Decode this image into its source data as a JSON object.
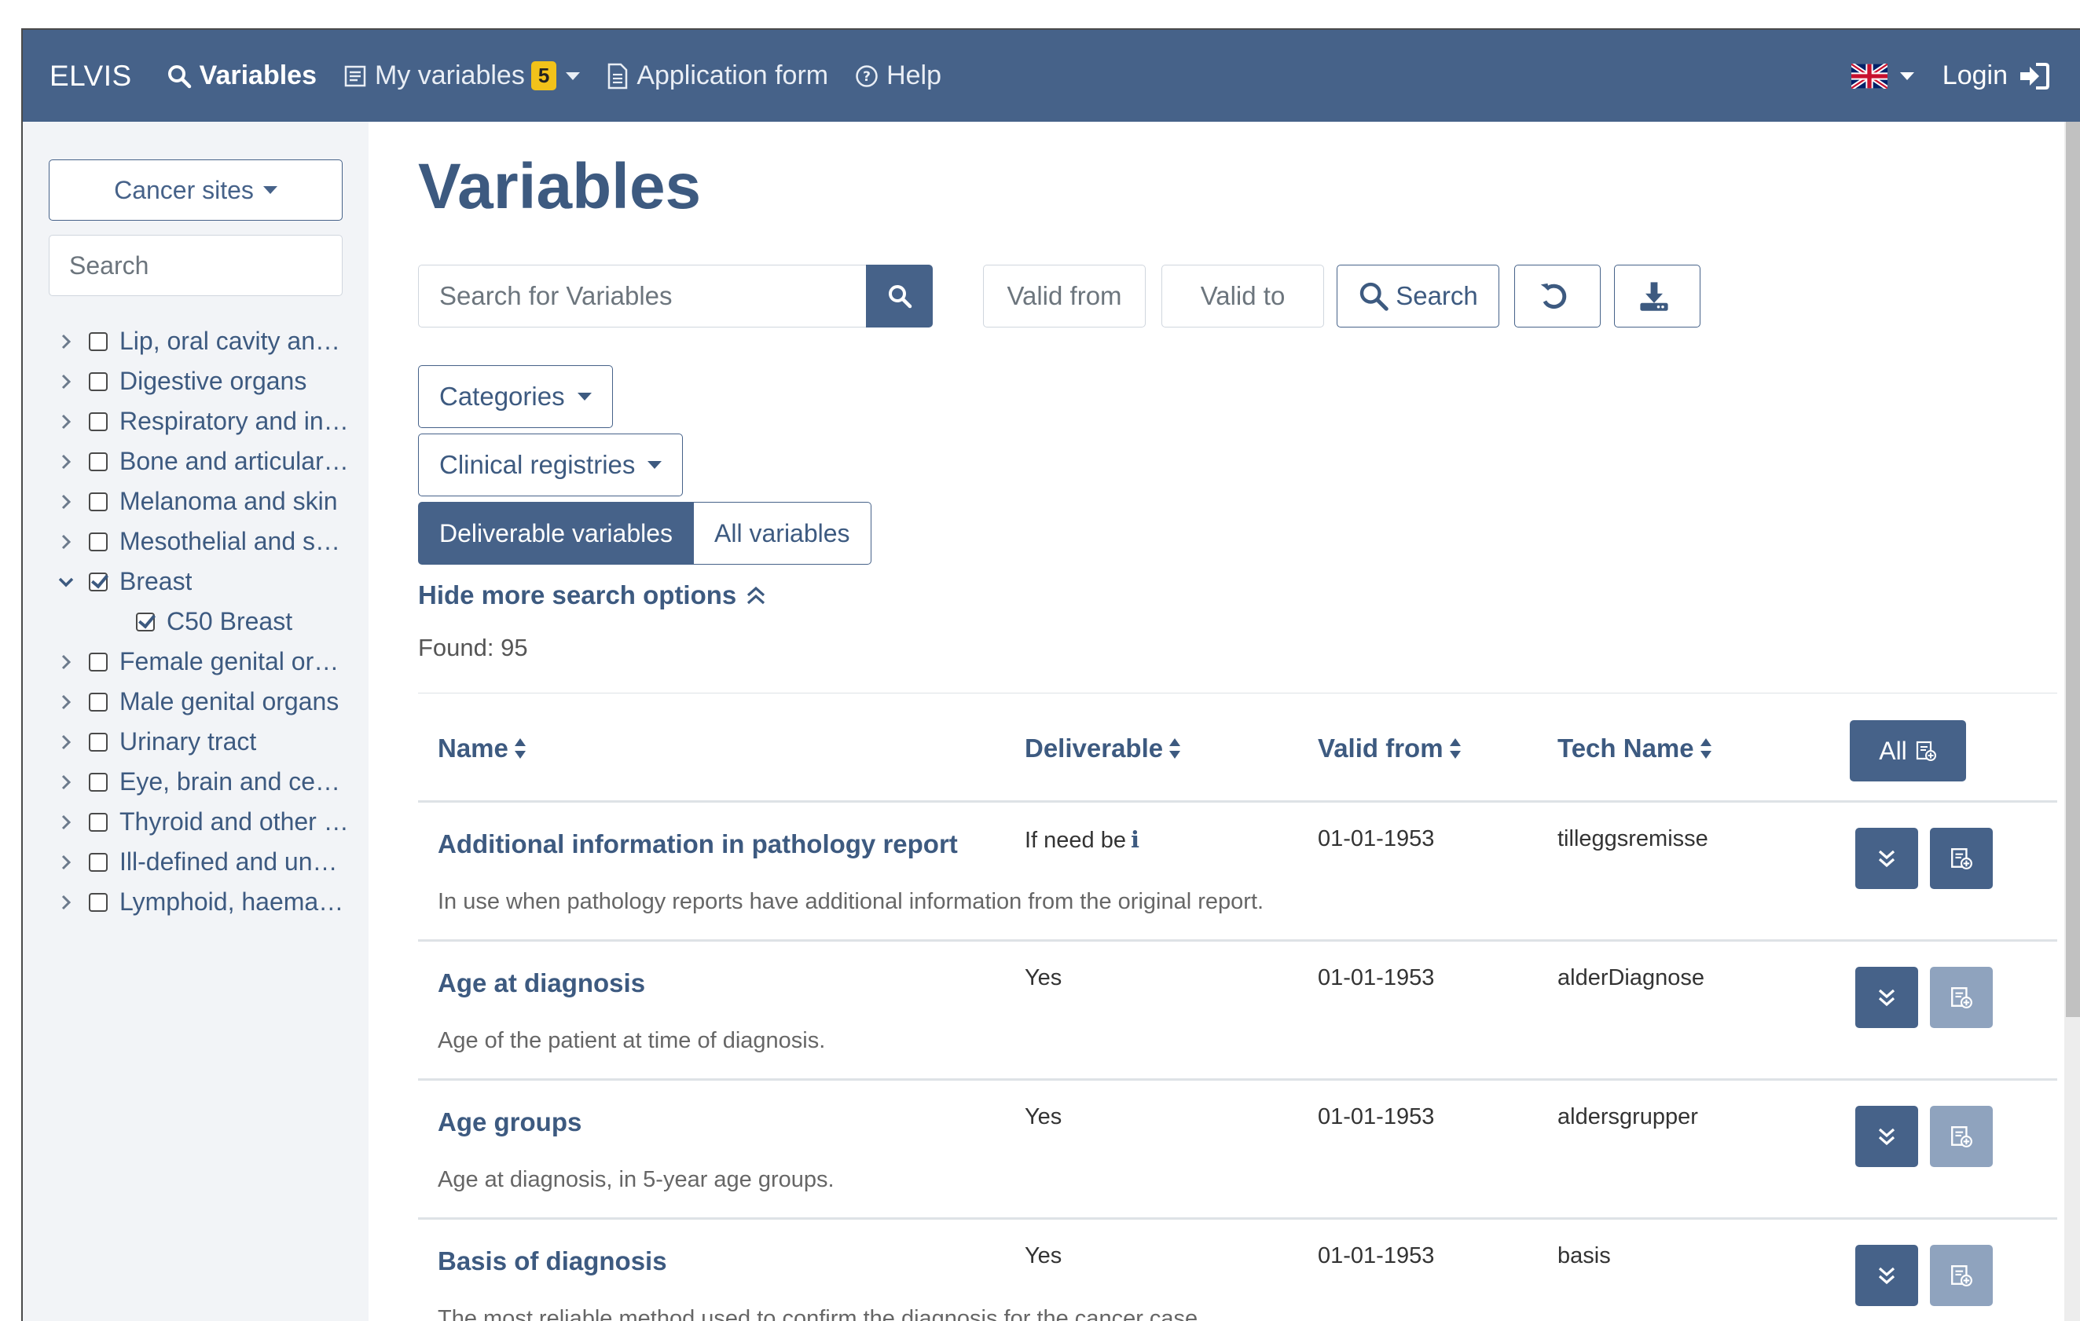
{
  "navbar": {
    "brand": "ELVIS",
    "variables": "Variables",
    "my_variables": "My variables",
    "my_variables_count": "5",
    "application_form": "Application form",
    "help": "Help",
    "login": "Login"
  },
  "sidebar": {
    "cancer_sites_label": "Cancer sites",
    "search_placeholder": "Search",
    "items": [
      {
        "label": "Lip, oral cavity an…",
        "checked": false,
        "expanded": false
      },
      {
        "label": "Digestive organs",
        "checked": false,
        "expanded": false
      },
      {
        "label": "Respiratory and in…",
        "checked": false,
        "expanded": false
      },
      {
        "label": "Bone and articular…",
        "checked": false,
        "expanded": false
      },
      {
        "label": "Melanoma and skin",
        "checked": false,
        "expanded": false
      },
      {
        "label": "Mesothelial and s…",
        "checked": false,
        "expanded": false
      },
      {
        "label": "Breast",
        "checked": true,
        "expanded": true
      },
      {
        "label": "C50 Breast",
        "checked": true,
        "child": true
      },
      {
        "label": "Female genital or…",
        "checked": false,
        "expanded": false
      },
      {
        "label": "Male genital organs",
        "checked": false,
        "expanded": false
      },
      {
        "label": "Urinary tract",
        "checked": false,
        "expanded": false
      },
      {
        "label": "Eye, brain and ce…",
        "checked": false,
        "expanded": false
      },
      {
        "label": "Thyroid and other …",
        "checked": false,
        "expanded": false
      },
      {
        "label": "Ill-defined and un…",
        "checked": false,
        "expanded": false
      },
      {
        "label": "Lymphoid, haema…",
        "checked": false,
        "expanded": false
      }
    ]
  },
  "main": {
    "title": "Variables",
    "search_placeholder": "Search for Variables",
    "valid_from_placeholder": "Valid from",
    "valid_to_placeholder": "Valid to",
    "search_button": "Search",
    "categories_label": "Categories",
    "clinical_registries_label": "Clinical registries",
    "toggle_deliverable": "Deliverable variables",
    "toggle_all": "All variables",
    "hide_options": "Hide more search options",
    "found": "Found: 95"
  },
  "table": {
    "headers": {
      "name": "Name",
      "deliverable": "Deliverable",
      "valid_from": "Valid from",
      "tech_name": "Tech Name",
      "all_button": "All"
    },
    "rows": [
      {
        "name": "Additional information in pathology report",
        "deliverable": "If need be",
        "info": true,
        "valid_from": "01-01-1953",
        "tech_name": "tilleggsremisse",
        "description": "In use when pathology reports have additional information from the original report.",
        "add_enabled": true
      },
      {
        "name": "Age at diagnosis",
        "deliverable": "Yes",
        "info": false,
        "valid_from": "01-01-1953",
        "tech_name": "alderDiagnose",
        "description": "Age of the patient at time of diagnosis.",
        "add_enabled": false
      },
      {
        "name": "Age groups",
        "deliverable": "Yes",
        "info": false,
        "valid_from": "01-01-1953",
        "tech_name": "aldersgrupper",
        "description": "Age at diagnosis, in 5-year age groups.",
        "add_enabled": false
      },
      {
        "name": "Basis of diagnosis",
        "deliverable": "Yes",
        "info": false,
        "valid_from": "01-01-1953",
        "tech_name": "basis",
        "description": "The most reliable method used to confirm the diagnosis for the cancer case.",
        "add_enabled": false
      }
    ]
  },
  "colors": {
    "primary": "#466289",
    "primary_text": "#3d5a80",
    "badge": "#f2c21a",
    "disabled_button": "#8fa3be",
    "sidebar_bg": "#f2f4f7"
  }
}
